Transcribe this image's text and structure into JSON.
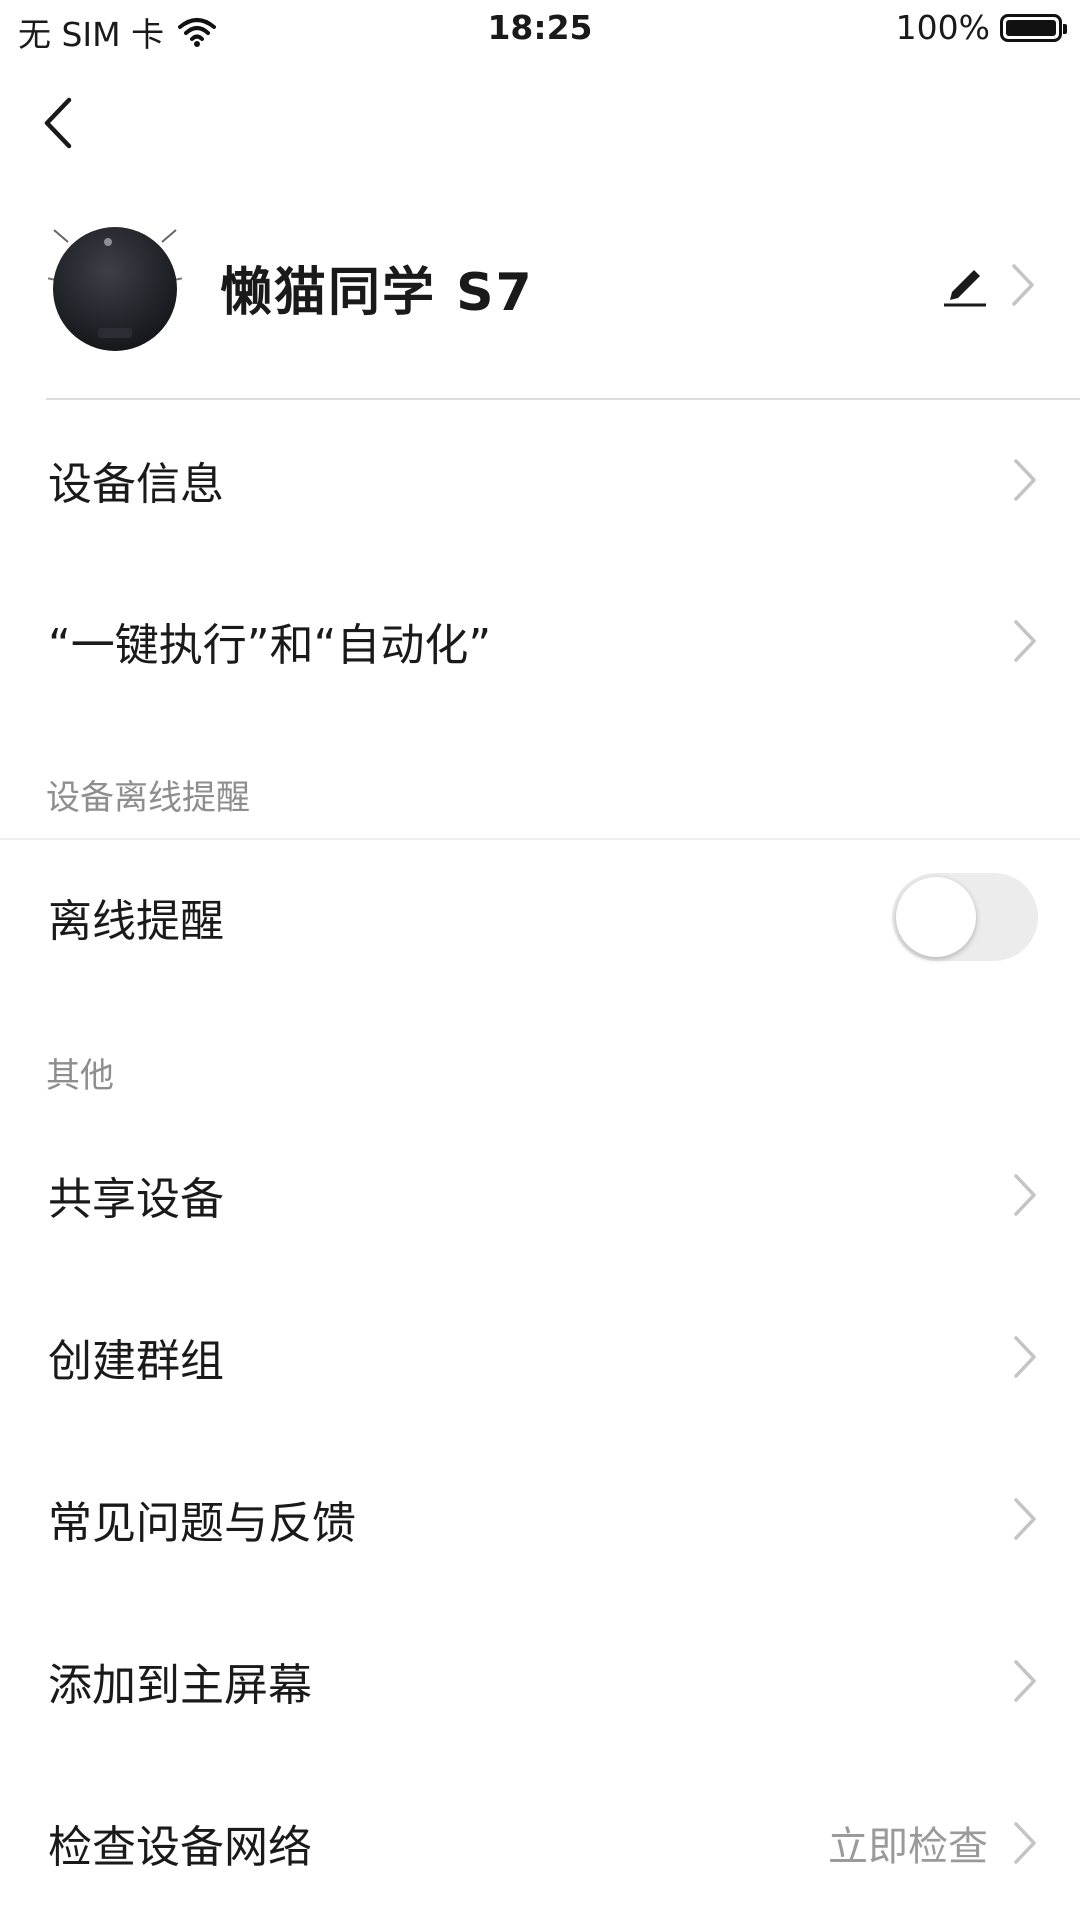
{
  "status_bar": {
    "carrier": "无 SIM 卡",
    "time": "18:25",
    "battery_text": "100%",
    "battery_level": 1.0,
    "wifi_icon": "wifi-icon"
  },
  "header": {
    "back_icon": "back-arrow-icon",
    "device_name": "懒猫同学 S7",
    "edit_icon": "pencil-icon"
  },
  "menu_top": [
    {
      "label": "设备信息"
    },
    {
      "label": "“一键执行”和“自动化”"
    }
  ],
  "offline_section": {
    "title": "设备离线提醒",
    "toggle_label": "离线提醒",
    "toggle_on": false
  },
  "other_section": {
    "title": "其他",
    "items": [
      {
        "label": "共享设备"
      },
      {
        "label": "创建群组"
      },
      {
        "label": "常见问题与反馈"
      },
      {
        "label": "添加到主屏幕"
      },
      {
        "label": "检查设备网络",
        "value": "立即检查"
      }
    ]
  },
  "colors": {
    "text": "#1a1a1a",
    "secondary_text": "#8e8e8e",
    "chevron": "#c4c4c4",
    "toggle_off": "#ececec"
  }
}
